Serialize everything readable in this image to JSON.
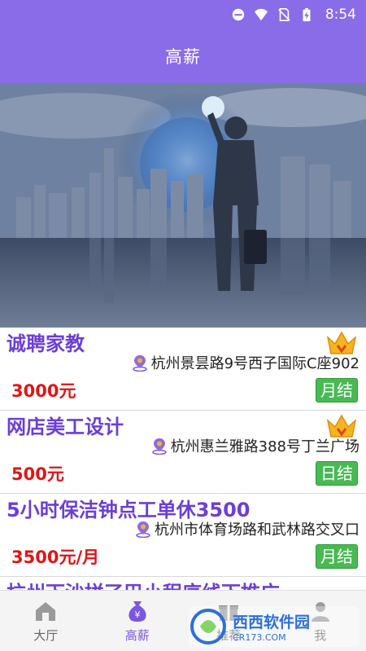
{
  "status_bar": {
    "time": "8:54"
  },
  "header": {
    "title": "高薪"
  },
  "jobs": [
    {
      "title": "诚聘家教",
      "location": "杭州景昙路9号西子国际C座902",
      "salary": "3000元",
      "pay_type": "月结",
      "crown": true
    },
    {
      "title": "网店美工设计",
      "location": "杭州惠兰雅路388号丁兰广场",
      "salary": "500元",
      "pay_type": "日结",
      "crown": true
    },
    {
      "title": "5小时保洁钟点工单休3500",
      "location": "杭州市体育场路和武林路交叉口",
      "salary": "3500元/月",
      "pay_type": "月结",
      "crown": false
    },
    {
      "title": "杭州下沙拼了巴小程序线下推广",
      "location": "",
      "salary": "",
      "pay_type": "",
      "crown": false
    }
  ],
  "tabs": [
    {
      "label": "大厅",
      "icon": "home-icon"
    },
    {
      "label": "高薪",
      "icon": "money-bag-icon"
    },
    {
      "label": "推荐",
      "icon": "gift-icon"
    },
    {
      "label": "我",
      "icon": "person-icon"
    }
  ],
  "watermark": {
    "main": "西西软件园",
    "sub": "CR173.COM"
  },
  "colors": {
    "accent": "#8a6be8",
    "title_purple": "#6b3fd6",
    "salary_red": "#e01515",
    "pay_green": "#49b954"
  }
}
